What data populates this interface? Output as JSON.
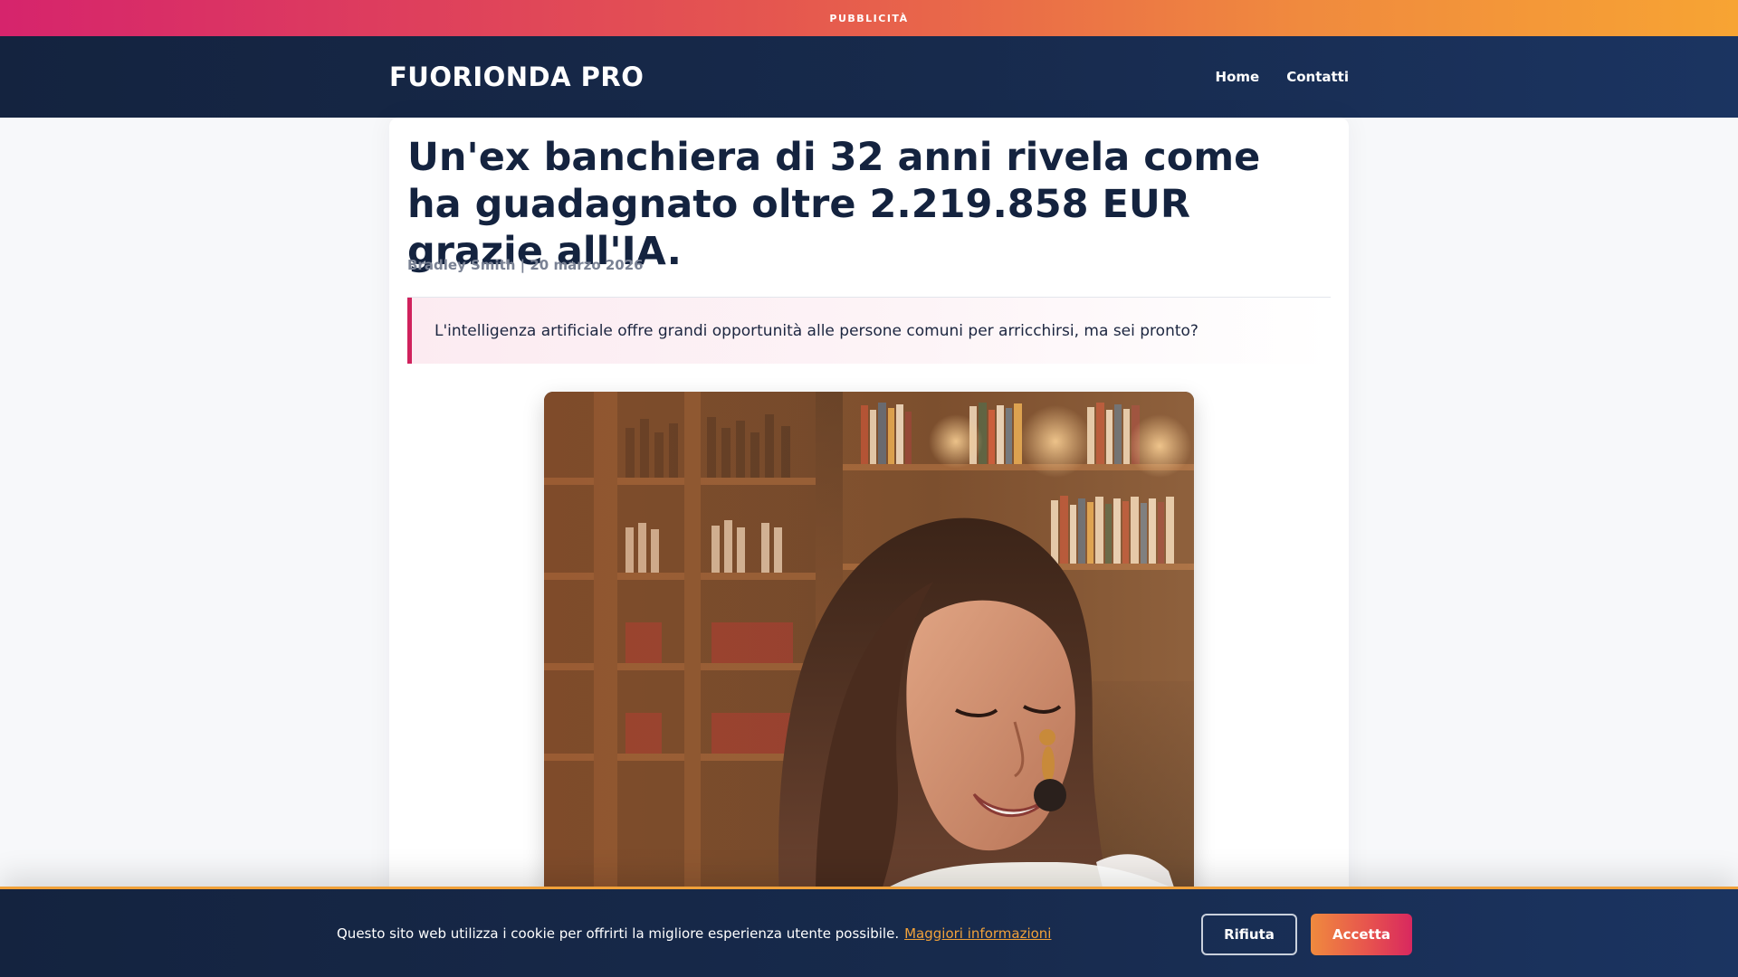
{
  "ad_banner": {
    "label": "PUBBLICITÀ"
  },
  "header": {
    "brand": "FUORIONDA PRO",
    "nav": [
      {
        "label": "Home"
      },
      {
        "label": "Contatti"
      }
    ]
  },
  "article": {
    "headline": "Un'ex banchiera di 32 anni rivela come ha guadagnato oltre 2.219.858 EUR grazie all'IA.",
    "meta": "Bradley Smith | 20 marzo 2026",
    "lede": "L'intelligenza artificiale offre grandi opportunità alle persone comuni per arricchirsi, ma sei pronto?",
    "hero_image": {
      "icon": "photo-woman-smiling-in-bar"
    }
  },
  "cookie_bar": {
    "text": "Questo sito web utilizza i cookie per offrirti la migliore esperienza utente possibile.",
    "link": "Maggiori informazioni",
    "reject_label": "Rifiuta",
    "accept_label": "Accetta"
  },
  "colors": {
    "navy": "#14233f",
    "accent_pink": "#d0225d",
    "accent_orange": "#f0a13a"
  }
}
